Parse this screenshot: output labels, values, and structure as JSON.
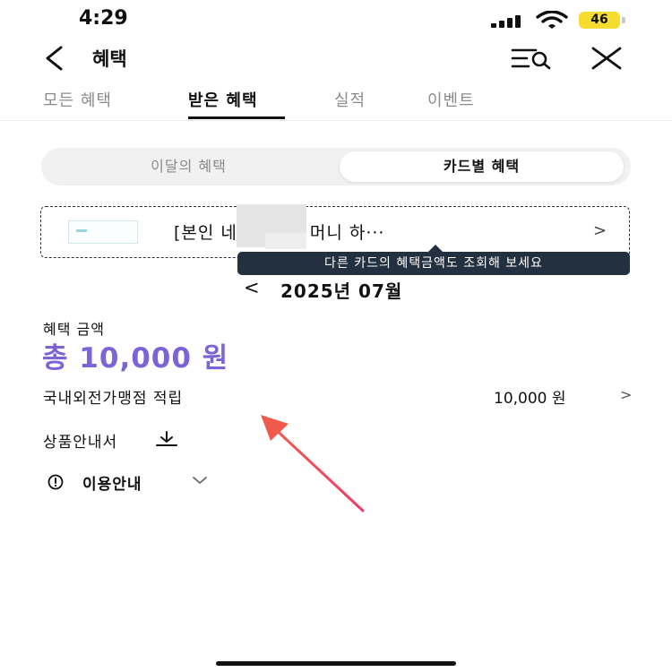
{
  "status_bar": {
    "time": "4:29",
    "battery": "46"
  },
  "header": {
    "title": "혜택"
  },
  "tabs": [
    {
      "label": "모든 혜택"
    },
    {
      "label": "받은 혜택"
    },
    {
      "label": "실적"
    },
    {
      "label": "이벤트"
    }
  ],
  "segment": {
    "left": "이달의 혜택",
    "right": "카드별 혜택"
  },
  "card_selector": {
    "name": "[본인   네이버페이 머니 하···",
    "chevron": ">"
  },
  "tooltip": {
    "text": "다른 카드의 혜택금액도 조회해 보세요"
  },
  "month_nav": {
    "prev": "<",
    "label": "2025년 07월"
  },
  "benefit": {
    "label": "혜택 금액",
    "total": "총 10,000 원",
    "rows": [
      {
        "name": "국내외전가맹점 적립",
        "amount": "10,000 원",
        "chevron": ">"
      }
    ]
  },
  "product_guide": {
    "label": "상품안내서"
  },
  "usage_guide": {
    "label": "이용안내"
  },
  "colors": {
    "accent": "#7c64d8",
    "tooltip_bg": "#233040",
    "annotation_arrow": "#ee4060"
  }
}
